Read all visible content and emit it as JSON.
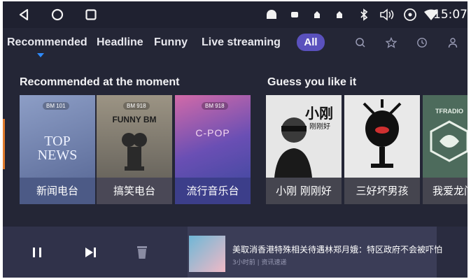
{
  "status_bar": {
    "time": "15:07",
    "nav_icons": [
      "back-icon",
      "home-icon",
      "recents-icon"
    ],
    "system_icons": [
      "android-icon",
      "notification-icon",
      "notification-icon",
      "notification-icon",
      "bluetooth-icon",
      "volume-icon",
      "hotspot-icon",
      "wifi-icon"
    ]
  },
  "tabs": {
    "items": [
      "Recommended",
      "Headline",
      "Funny",
      "Live streaming"
    ],
    "active_index": 0,
    "all_label": "All",
    "tools": [
      "search-icon",
      "star-icon",
      "history-icon",
      "user-icon"
    ],
    "accent": "#5a51bd",
    "indicator_color": "#2e8bff"
  },
  "sections": {
    "recommended_title": "Recommended at the moment",
    "guess_title": "Guess you like it"
  },
  "cards": {
    "recommended": [
      {
        "caption": "新闻电台",
        "art_badge": "BM 101",
        "art_line1": "TOP",
        "art_line2": "NEWS"
      },
      {
        "caption": "搞笑电台",
        "art_badge": "BM 918",
        "art_line1": "FUNNY BM",
        "art_line2": ""
      },
      {
        "caption": "流行音乐台",
        "art_badge": "BM 918",
        "art_line1": "C-POP",
        "art_line2": ""
      }
    ],
    "guess": [
      {
        "caption": "小刚 刚刚好",
        "art_line1": "小刚",
        "art_line2": "刚刚好"
      },
      {
        "caption": "三好坏男孩",
        "art_line1": "",
        "art_line2": ""
      },
      {
        "caption": "我爱龙门",
        "art_line1": "TFRADIO",
        "art_line2": ""
      }
    ]
  },
  "player": {
    "controls": [
      "pause-icon",
      "next-icon",
      "delete-icon"
    ],
    "now_playing_title": "美取消香港特殊相关待遇林郑月娥：特区政府不会被吓怕",
    "now_playing_subtitle": "3小时前 | 资讯速递"
  },
  "colors": {
    "background": "#242636",
    "player": "#30324a",
    "now_playing": "#3b3d57"
  }
}
